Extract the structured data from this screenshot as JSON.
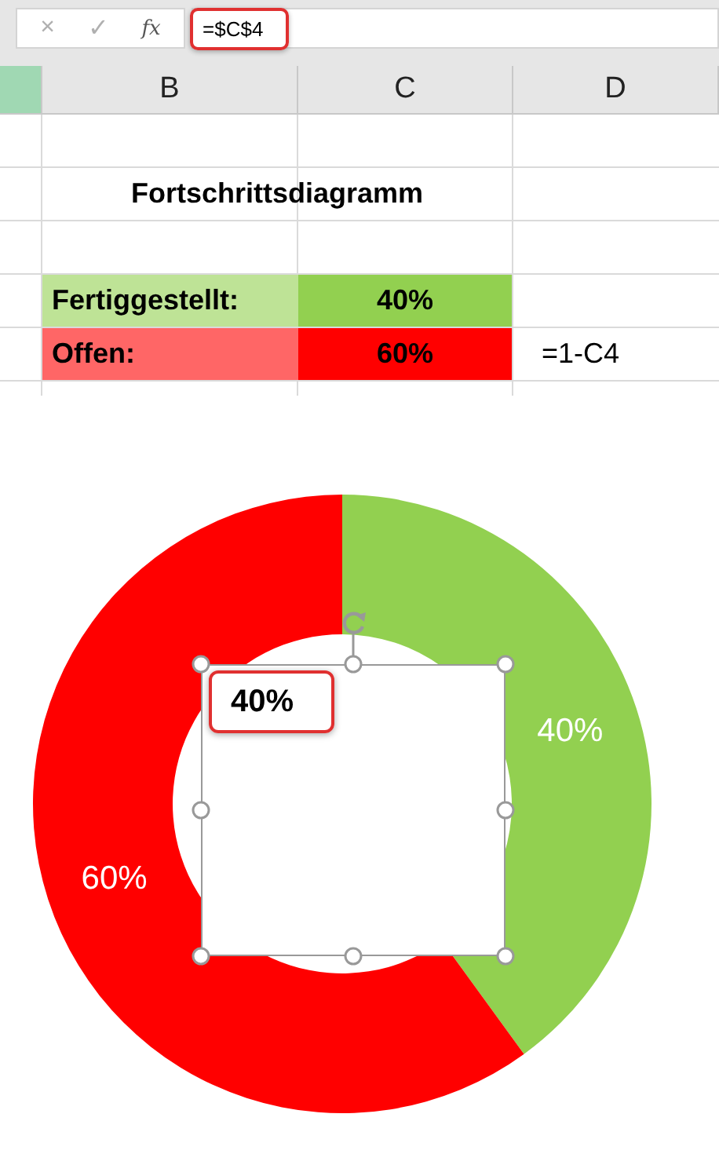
{
  "formula_bar": {
    "cancel": "×",
    "enter": "✓",
    "function": "fx",
    "formula": "=$C$4",
    "highlighted": true
  },
  "sheet": {
    "column_a": {
      "selected": true
    },
    "column_headers": [
      {
        "label": "B",
        "selected": false
      },
      {
        "label": "C",
        "selected": false
      },
      {
        "label": "D",
        "selected": false
      }
    ],
    "rows": [
      {
        "kind": "blank"
      },
      {
        "kind": "title",
        "text": "Fortschrittsdiagramm"
      },
      {
        "kind": "blank"
      },
      {
        "kind": "data",
        "label": "Fertiggestellt:",
        "value": "40%",
        "color": "#92d050"
      },
      {
        "kind": "data",
        "label": "Offen:",
        "value": "60%",
        "color": "#ff0000",
        "note": "=1-C4"
      },
      {
        "kind": "blank"
      }
    ]
  },
  "chart": {
    "chart_data": {
      "type": "donut",
      "series": [
        {
          "values": [
            40,
            60
          ]
        }
      ],
      "value_labels": [
        "40%",
        "60%"
      ]
    },
    "text_box": {
      "text": "40%",
      "selected": true,
      "highlighted": true
    }
  }
}
